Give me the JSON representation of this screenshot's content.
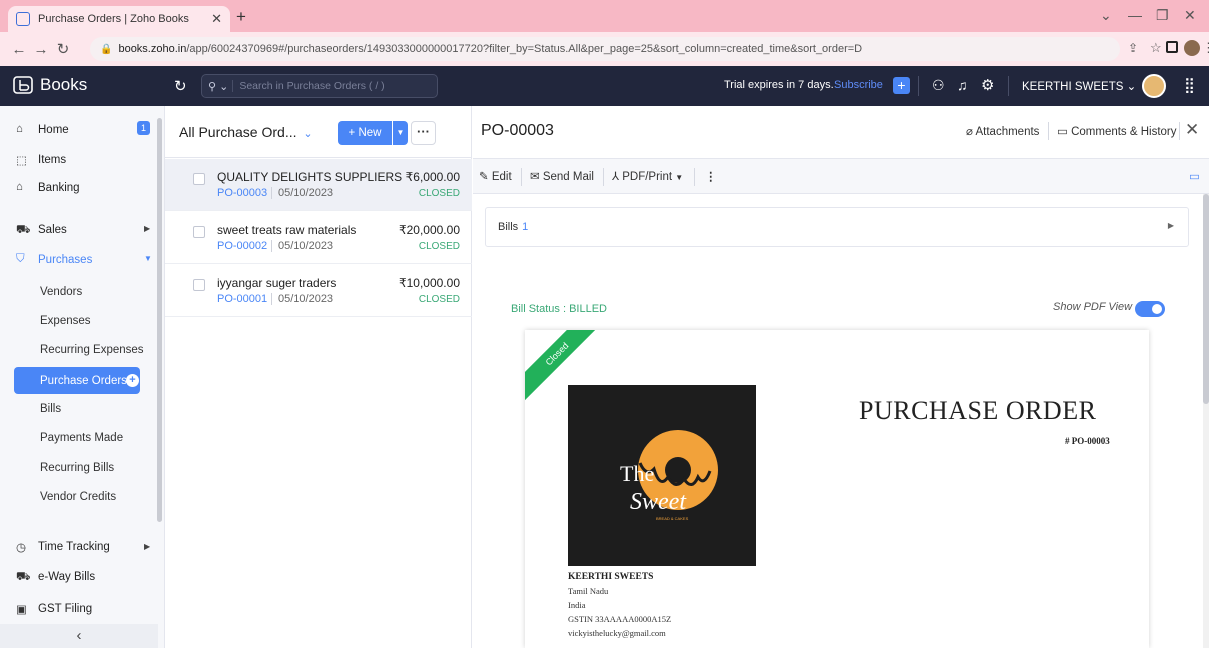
{
  "browser": {
    "tab_title": "Purchase Orders | Zoho Books",
    "url_host": "books.zoho.in",
    "url_path": "/app/60024370969#/purchaseorders/1493033000000017720?filter_by=Status.All&per_page=25&sort_column=created_time&sort_order=D"
  },
  "header": {
    "brand": "Books",
    "search_placeholder": "Search in Purchase Orders ( / )",
    "trial_text": "Trial expires in 7 days.",
    "subscribe": "Subscribe",
    "org_name": "KEERTHI SWEETS",
    "colors": {
      "bar": "#21263c",
      "accent": "#4a86f6"
    }
  },
  "sidebar": {
    "home": "Home",
    "home_badge": "1",
    "items": "Items",
    "banking": "Banking",
    "sales": "Sales",
    "purchases": "Purchases",
    "purchase_sub": [
      "Vendors",
      "Expenses",
      "Recurring Expenses",
      "Purchase Orders",
      "Bills",
      "Payments Made",
      "Recurring Bills",
      "Vendor Credits"
    ],
    "time_tracking": "Time Tracking",
    "eway": "e-Way Bills",
    "gst": "GST Filing"
  },
  "list": {
    "view_label": "All Purchase Ord...",
    "new_label": "+ New",
    "rows": [
      {
        "vendor": "QUALITY DELIGHTS SUPPLIERS",
        "amount": "₹6,000.00",
        "po": "PO-00003",
        "date": "05/10/2023",
        "status": "CLOSED"
      },
      {
        "vendor": "sweet treats raw materials",
        "amount": "₹20,000.00",
        "po": "PO-00002",
        "date": "05/10/2023",
        "status": "CLOSED"
      },
      {
        "vendor": "iyyangar suger traders",
        "amount": "₹10,000.00",
        "po": "PO-00001",
        "date": "05/10/2023",
        "status": "CLOSED"
      }
    ]
  },
  "detail": {
    "title": "PO-00003",
    "attachments": "Attachments",
    "comments": "Comments & History",
    "toolbar": {
      "edit": "Edit",
      "send_mail": "Send Mail",
      "pdf_print": "PDF/Print"
    },
    "bills_label": "Bills",
    "bills_count": "1",
    "bill_status_label": "Bill Status :",
    "bill_status_value": "BILLED",
    "show_pdf_view": "Show PDF View",
    "pdf_view_on": true
  },
  "pdf": {
    "ribbon": "Closed",
    "heading": "PURCHASE ORDER",
    "number": "# PO-00003",
    "logo_text_1": "The",
    "logo_text_2": "Sweet",
    "logo_tagline": "BREAD & CAKES",
    "company": "KEERTHI SWEETS",
    "state": "Tamil Nadu",
    "country": "India",
    "gstin": "GSTIN 33AAAAA0000A15Z",
    "email": "vickyisthelucky@gmail.com"
  }
}
